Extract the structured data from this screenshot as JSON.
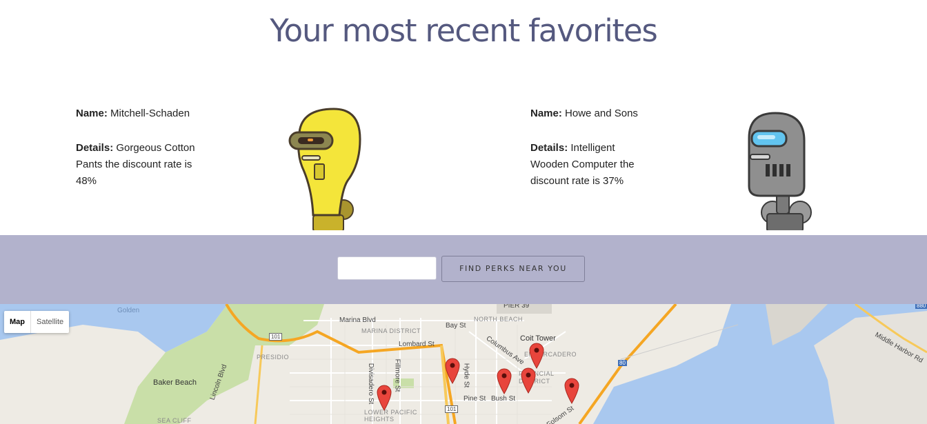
{
  "page": {
    "heading": "Your most recent favorites"
  },
  "favorites": [
    {
      "name_label": "Name:",
      "name": "Mitchell-Schaden",
      "details_label": "Details:",
      "details": "Gorgeous Cotton Pants the discount rate is 48%",
      "robot_color": "#f4e53a"
    },
    {
      "name_label": "Name:",
      "name": "Howe and Sons",
      "details_label": "Details:",
      "details": "Intelligent Wooden Computer the discount rate is 37%",
      "robot_color": "#8f8f8f"
    }
  ],
  "search": {
    "placeholder": "",
    "value": "",
    "button_label": "FIND PERKS NEAR YOU"
  },
  "map": {
    "type_control": {
      "map_label": "Map",
      "satellite_label": "Satellite"
    },
    "labels": {
      "golden": "Golden",
      "pier39": "PIER 39",
      "marina_blvd": "Marina Blvd",
      "bay_st": "Bay St",
      "north_beach": "NORTH BEACH",
      "marina_district": "MARINA DISTRICT",
      "coit_tower": "Coit Tower",
      "lombard_st": "Lombard St",
      "presidio": "PRESIDIO",
      "columbus_ave": "Columbus Ave",
      "embarcadero": "EMBARCADERO",
      "financial_district": "FINANCIAL DISTRICT",
      "baker_beach": "Baker Beach",
      "lincoln_blvd": "Lincoln Blvd",
      "divisadero_st": "Divisadero St",
      "fillmore_st": "Fillmore St",
      "hyde_st": "Hyde St",
      "pine_st": "Pine St",
      "bush_st": "Bush St",
      "lower_pacific_heights": "LOWER PACIFIC HEIGHTS",
      "sea_cliff": "SEA CLIFF",
      "folsom_st": "Folsom St",
      "middle_harbor_rd": "Middle Harbor Rd",
      "hwy_101": "101",
      "hwy_80": "80",
      "hwy_880": "880"
    },
    "markers": 6,
    "colors": {
      "water": "#a9c8ef",
      "park": "#c9dfa8",
      "land": "#eeebe4",
      "highway": "#f5a623",
      "marker": "#e8453c"
    }
  }
}
